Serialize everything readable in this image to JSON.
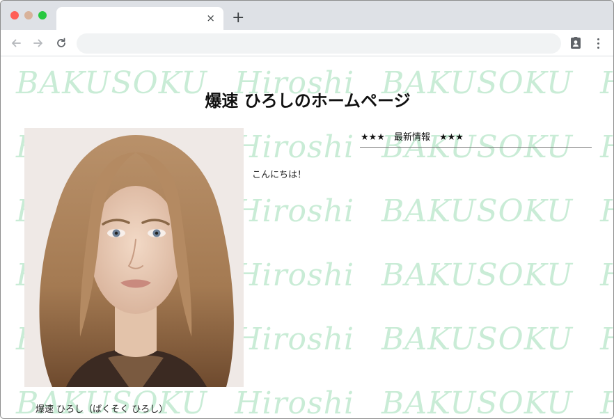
{
  "browser": {
    "tab_close_glyph": "×",
    "new_tab_glyph": "+",
    "address": "",
    "icons": [
      "back-arrow-icon",
      "forward-arrow-icon",
      "reload-icon",
      "profile-icon",
      "kebab-menu-icon"
    ]
  },
  "page": {
    "watermark_text": "BAKUSOKU Hiroshi BAKUSOKU Hiroshi BAKUSOKU Hiroshi",
    "watermark_color": "#c9ecd6",
    "title": "爆速 ひろしのホームページ",
    "caption": "爆速 ひろし（ばくそく ひろし）",
    "news_heading": "★★★　最新情報　★★★",
    "news_body": "こんにちは！"
  }
}
